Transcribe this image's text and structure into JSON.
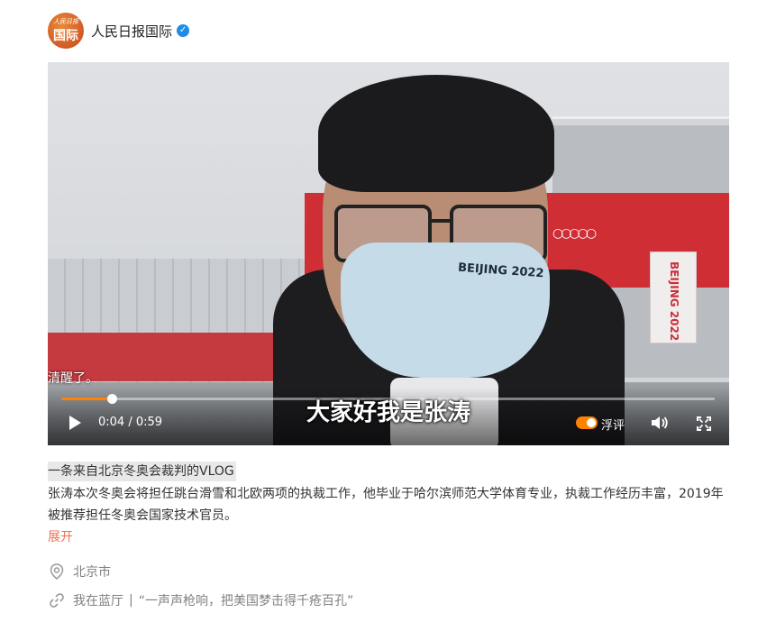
{
  "account": {
    "name": "人民日报国际",
    "avatar_text": "国际",
    "avatar_signature": "人民日报"
  },
  "video": {
    "mask_text": "BEIJING 2022",
    "banner_text": "BEIJING 2022",
    "subtitle_prev": "清醒了。",
    "subtitle_main": "大家好我是张涛",
    "time": "0:04 / 0:59",
    "progress": 0.077,
    "danmu_label": "浮评",
    "accent": "#ff8200"
  },
  "post": {
    "title": "一条来自北京冬奥会裁判的VLOG",
    "body": "张涛本次冬奥会将担任跳台滑雪和北欧两项的执裁工作，他毕业于哈尔滨师范大学体育专业，执裁工作经历丰富，2019年被推荐担任冬奥会国家技术官员。",
    "expand": "展开",
    "location": "北京市",
    "link_source": "我在蓝厅",
    "link_separator": "|",
    "link_title": "“一声声枪响，把美国梦击得千疮百孔”"
  }
}
